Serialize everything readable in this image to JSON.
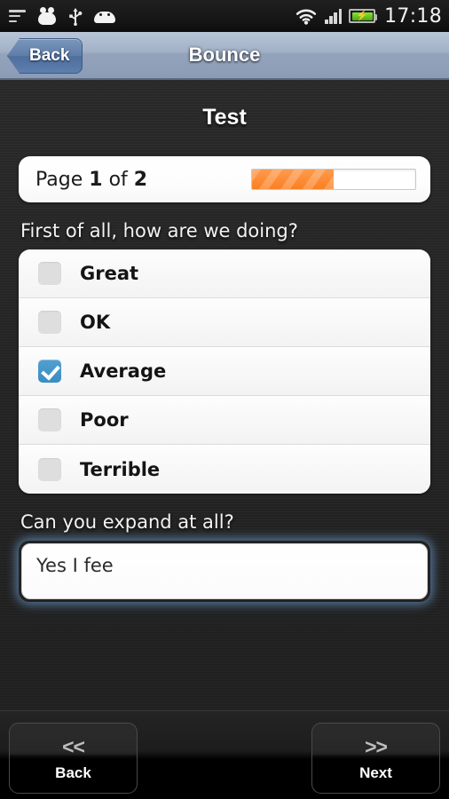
{
  "statusbar": {
    "icons_left": [
      "list-icon",
      "blob-icon",
      "usb-icon",
      "android-icon"
    ],
    "icons_right": [
      "wifi-icon",
      "signal-icon",
      "battery-charging-icon"
    ],
    "time": "17:18",
    "battery_bolt": "⚡"
  },
  "titlebar": {
    "back_label": "Back",
    "title": "Bounce"
  },
  "page": {
    "heading": "Test",
    "page_prefix": "Page",
    "page_current": "1",
    "page_middle": "of",
    "page_total": "2",
    "progress_percent": 50
  },
  "questions": [
    {
      "label": "First of all, how are we doing?",
      "type": "checkbox-list",
      "options": [
        {
          "label": "Great",
          "checked": false
        },
        {
          "label": "OK",
          "checked": false
        },
        {
          "label": "Average",
          "checked": true
        },
        {
          "label": "Poor",
          "checked": false
        },
        {
          "label": "Terrible",
          "checked": false
        }
      ]
    },
    {
      "label": "Can you expand at all?",
      "type": "textarea",
      "value": "Yes I fee",
      "placeholder": ""
    }
  ],
  "footer": {
    "back": {
      "arrows": "<<",
      "label": "Back"
    },
    "next": {
      "arrows": ">>",
      "label": "Next"
    }
  },
  "colors": {
    "accent_orange": "#fa7f21",
    "checkbox_blue": "#3b8cc2",
    "titlebar_blue": "#a2b1c6",
    "background_dark": "#242424",
    "battery_green": "#6dc722"
  }
}
